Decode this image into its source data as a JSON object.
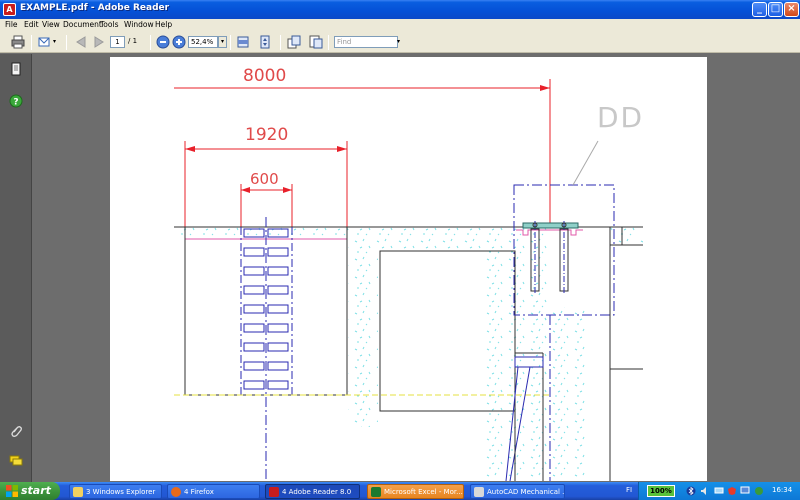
{
  "window": {
    "title": "EXAMPLE.pdf - Adobe Reader",
    "minimize": "_",
    "maximize": "□",
    "close": "×"
  },
  "menu": [
    "File",
    "Edit",
    "View",
    "Document",
    "Tools",
    "Window",
    "Help"
  ],
  "toolbar": {
    "page_current": "1",
    "page_total": "/ 1",
    "zoom": "52,4%",
    "zoom_dropdown": "▾",
    "find_placeholder": "Find",
    "find_dropdown": "▾"
  },
  "drawing": {
    "dim_8000": "8000",
    "dim_1920": "1920",
    "dim_600": "600",
    "section_label": "DD",
    "colors": {
      "red": "#e8202a",
      "pink": "#e05aa8",
      "blue": "#2a2ab0",
      "cyan": "#7fe0e6",
      "yellow": "#e6e040",
      "dark": "#303030"
    }
  },
  "taskbar": {
    "start": "start",
    "tasks": [
      {
        "label": "3 Windows Explorer"
      },
      {
        "label": "4 Firefox"
      },
      {
        "label": "4 Adobe Reader 8.0"
      },
      {
        "label": "Microsoft Excel - Mor..."
      },
      {
        "label": "AutoCAD Mechanical ..."
      }
    ],
    "language": "FI",
    "battery": "100%",
    "clock": "16:34"
  }
}
